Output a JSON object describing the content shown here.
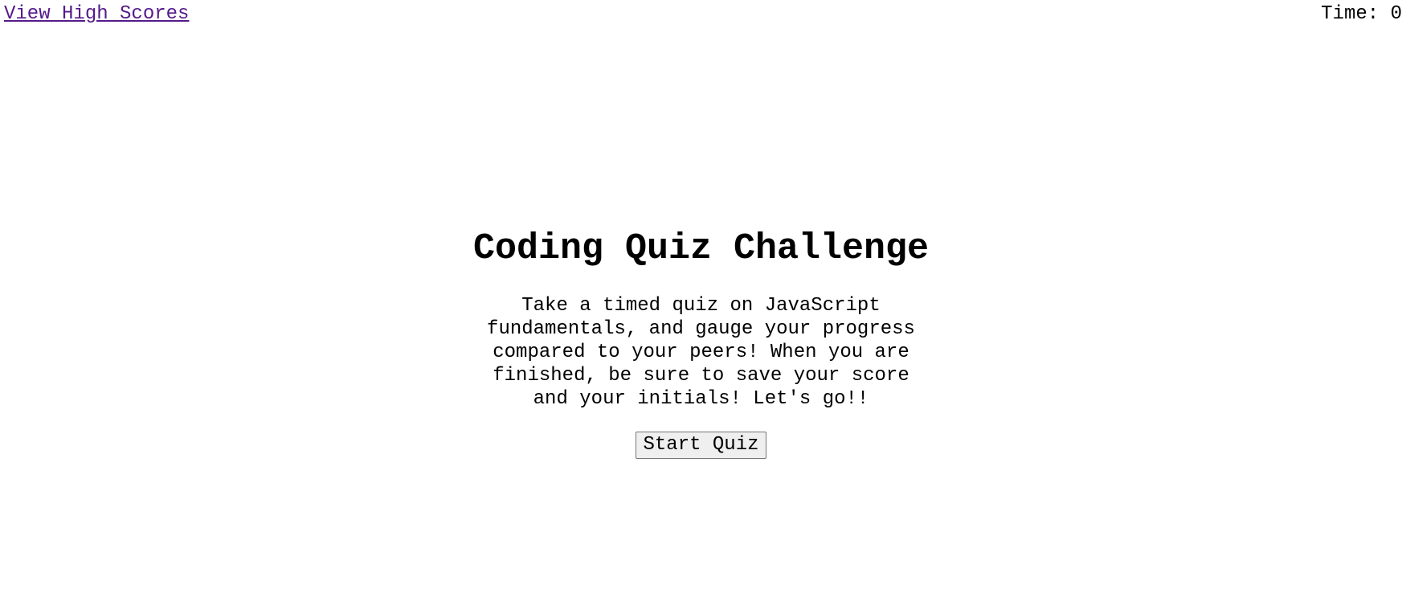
{
  "header": {
    "high_scores_link": "View High Scores",
    "timer_label": "Time:",
    "timer_value": "0"
  },
  "main": {
    "title": "Coding Quiz Challenge",
    "intro": "Take a timed quiz on JavaScript fundamentals, and gauge your progress compared to your peers! When you are finished, be sure to save your score and your initials! Let's go!!",
    "start_button": "Start Quiz"
  },
  "colors": {
    "link_visited": "#551a8b",
    "button_background": "#efefef",
    "button_border": "#767676",
    "text": "#000000",
    "background": "#ffffff"
  }
}
